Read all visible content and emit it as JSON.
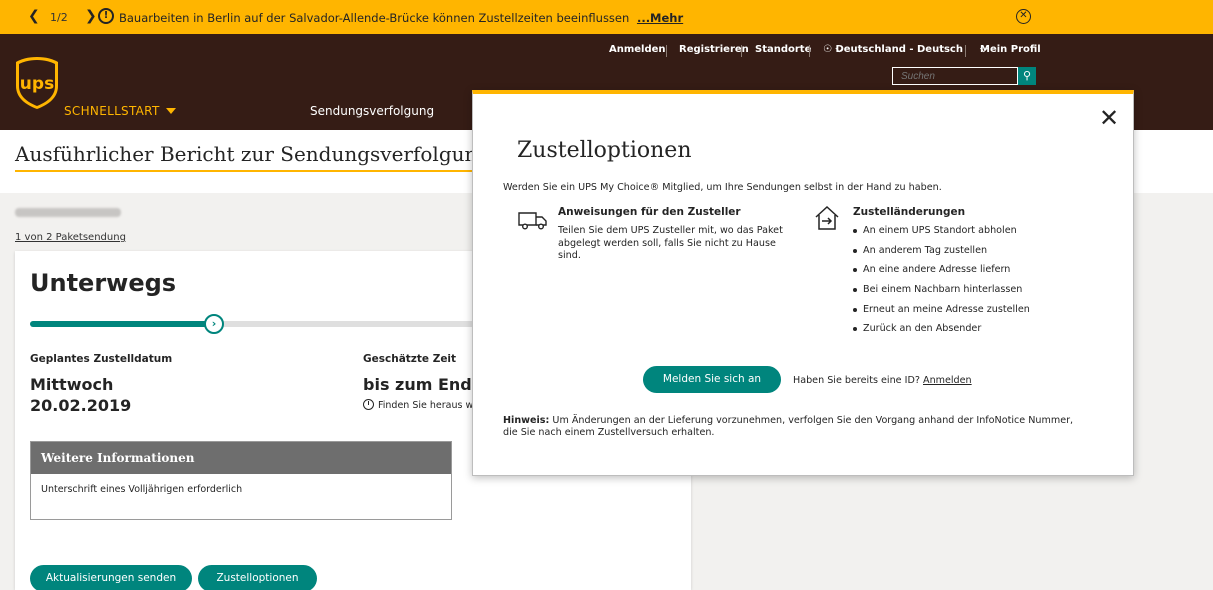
{
  "alert": {
    "counter": "1/2",
    "text": "Bauarbeiten in Berlin auf der Salvador-Allende-Brücke können Zustellzeiten beeinflussen",
    "more": "...Mehr"
  },
  "header": {
    "links": {
      "login": "Anmelden",
      "register": "Registrieren",
      "locations": "Standorte",
      "language": "Deutschland - Deutsch",
      "profile": "Mein Profil"
    },
    "search_placeholder": "Suchen",
    "quickstart": "SCHNELLSTART",
    "nav_tracking": "Sendungsverfolgung"
  },
  "page": {
    "title": "Ausführlicher Bericht zur Sendungsverfolgung",
    "package_count": "1 von 2 Paketsendung"
  },
  "shipment": {
    "status": "Unterwegs",
    "progress": 0.4,
    "planned_label": "Geplantes Zustelldatum",
    "planned_day": "Mittwoch",
    "planned_date": "20.02.2019",
    "time_label": "Geschätzte Zeit",
    "time_value": "bis zum Ende des Tages",
    "find_out": "Finden Sie heraus wann",
    "info_title": "Weitere Informationen",
    "info_text": "Unterschrift eines Volljährigen erforderlich",
    "btn_updates": "Aktualisierungen senden",
    "btn_options": "Zustelloptionen"
  },
  "modal": {
    "title": "Zustelloptionen",
    "intro": "Werden Sie ein UPS My Choice® Mitglied, um Ihre Sendungen selbst in der Hand zu haben.",
    "col1_head": "Anweisungen für den Zusteller",
    "col1_text": "Teilen Sie dem UPS Zusteller mit, wo das Paket abgelegt werden soll, falls Sie nicht zu Hause sind.",
    "col2_head": "Zustelländerungen",
    "col2_items": [
      "An einem UPS Standort abholen",
      "An anderem Tag zustellen",
      "An eine andere Adresse liefern",
      "Bei einem Nachbarn hinterlassen",
      "Erneut an meine Adresse zustellen",
      "Zurück an den Absender"
    ],
    "signin_button": "Melden Sie sich an",
    "have_id": "Haben Sie bereits eine ID?",
    "have_id_link": "Anmelden",
    "note_label": "Hinweis:",
    "note_text": "Um Änderungen an der Lieferung vorzunehmen, verfolgen Sie den Vorgang anhand der InfoNotice Nummer, die Sie nach einem Zustellversuch erhalten."
  },
  "colors": {
    "ups_brown": "#351c15",
    "ups_gold": "#ffb500",
    "ups_green": "#00857d"
  }
}
